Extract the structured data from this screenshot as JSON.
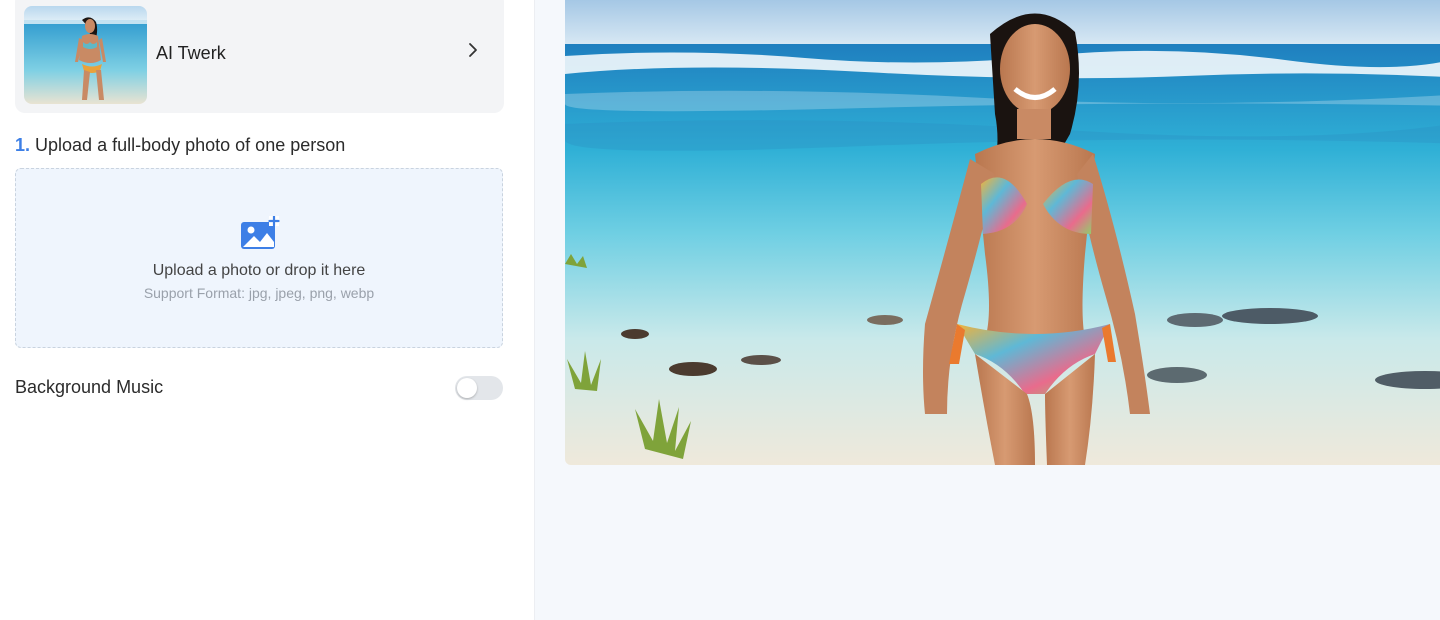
{
  "template": {
    "name": "AI Twerk",
    "thumbnail_icon": "beach-woman-thumbnail"
  },
  "upload_step": {
    "number": "1.",
    "title": "Upload a full-body photo of one person",
    "icon": "image-add-icon",
    "main_text": "Upload a photo or drop it here",
    "sub_text": "Support Format: jpg, jpeg, png, webp"
  },
  "background_music": {
    "label": "Background Music",
    "enabled": false
  },
  "preview": {
    "image": "beach-woman-preview"
  },
  "colors": {
    "accent": "#3d7fe6",
    "panel_bg": "#f3f4f6",
    "upload_bg": "#eff5fd",
    "right_bg": "#f5f8fc"
  }
}
